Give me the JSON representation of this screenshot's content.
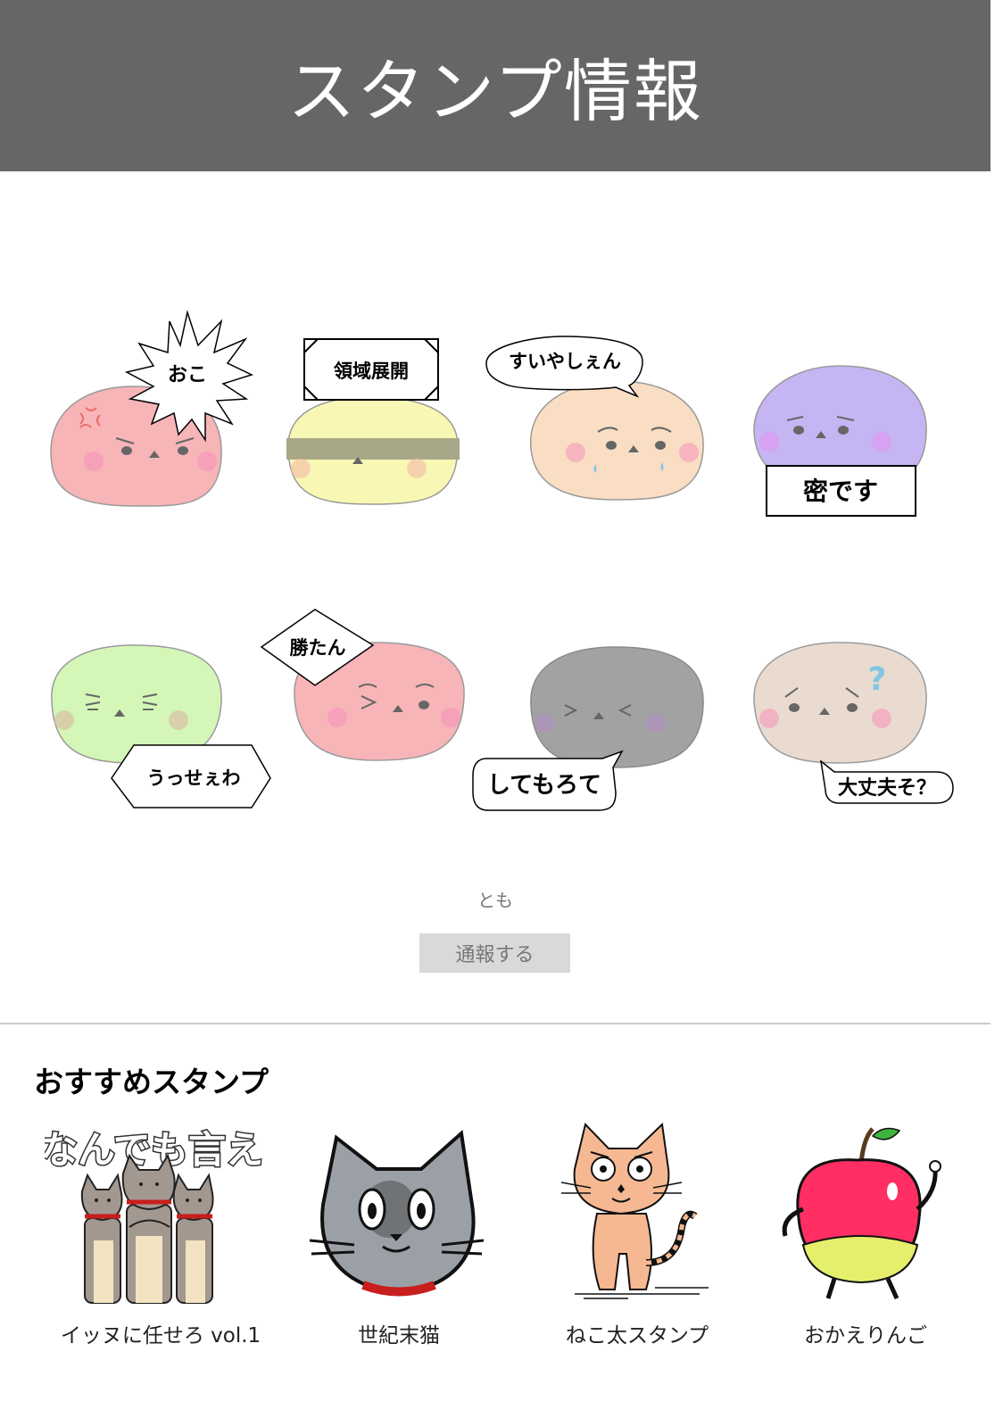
{
  "header": {
    "title": "スタンプ情報"
  },
  "stamps": [
    {
      "caption": "おこ",
      "color": "#f7b5b8"
    },
    {
      "caption": "領域展開",
      "color": "#f8f8b4"
    },
    {
      "caption": "すいやしぇん",
      "color": "#f9dec3"
    },
    {
      "caption": "密です",
      "color": "#c5b5f2"
    },
    {
      "caption": "うっせぇわ",
      "color": "#d4f7b8"
    },
    {
      "caption": "勝たん",
      "color": "#f7b5b8"
    },
    {
      "caption": "してもろて",
      "color": "#a2a2a2"
    },
    {
      "caption": "大丈夫そ？",
      "color": "#eadbd0"
    }
  ],
  "author": "とも",
  "report_label": "通報する",
  "recommend": {
    "title": "おすすめスタンプ",
    "items": [
      {
        "name": "イッヌに任せろ vol.1",
        "art_text": "なんでも言え"
      },
      {
        "name": "世紀末猫"
      },
      {
        "name": "ねこ太スタンプ"
      },
      {
        "name": "おかえりんご"
      }
    ]
  }
}
